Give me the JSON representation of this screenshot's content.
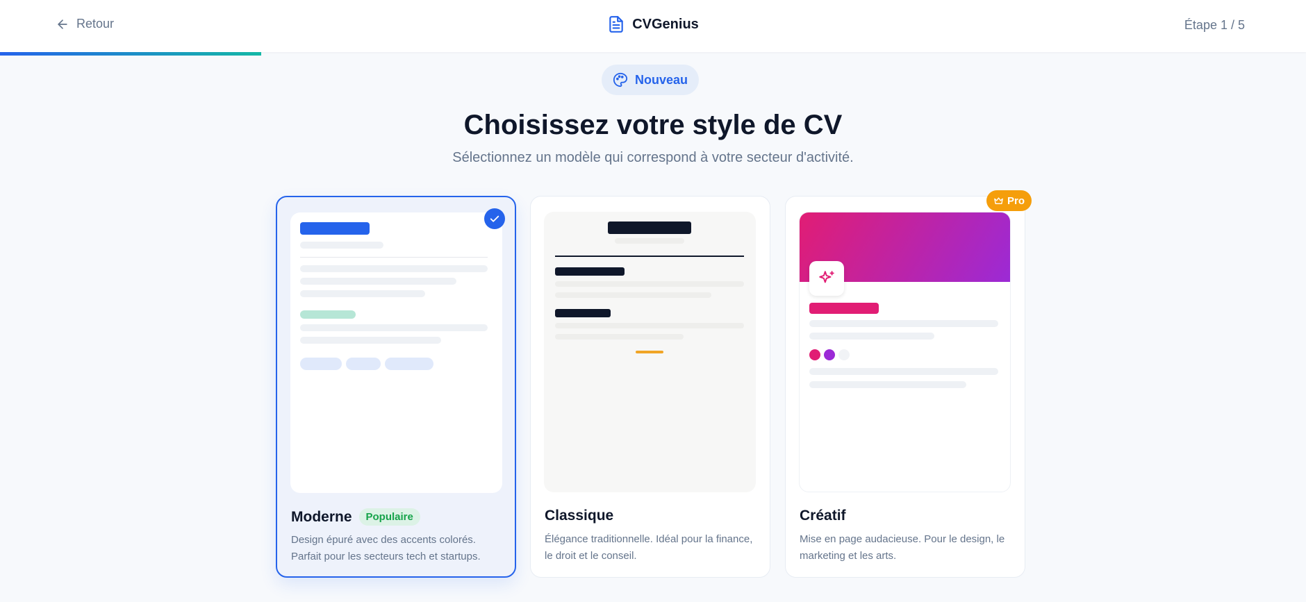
{
  "header": {
    "back_label": "Retour",
    "brand": "CVGenius",
    "step_label": "Étape 1 / 5",
    "progress": 0.2
  },
  "badge": {
    "label": "Nouveau"
  },
  "title": "Choisissez votre style de CV",
  "subtitle": "Sélectionnez un modèle qui correspond à votre secteur d'activité.",
  "templates": [
    {
      "name": "Moderne",
      "badge": "Populaire",
      "description": "Design épuré avec des accents colorés. Parfait pour les secteurs tech et startups.",
      "selected": true,
      "accent": "#2563eb"
    },
    {
      "name": "Classique",
      "description": "Élégance traditionnelle. Idéal pour la finance, le droit et le conseil.",
      "selected": false,
      "accent": "#0f172a"
    },
    {
      "name": "Créatif",
      "pro_label": "Pro",
      "description": "Mise en page audacieuse. Pour le design, le marketing et les arts.",
      "selected": false,
      "accent": "#e11d74"
    }
  ],
  "icons": [
    "arrow-left-icon",
    "document-icon",
    "palette-icon",
    "check-icon",
    "crown-icon",
    "sparkles-icon"
  ],
  "colors": {
    "primary": "#2563eb",
    "teal": "#14b8a6",
    "pro": "#f59e0b",
    "success": "#16a34a",
    "pink": "#e11d74",
    "purple": "#9b2ad6"
  }
}
